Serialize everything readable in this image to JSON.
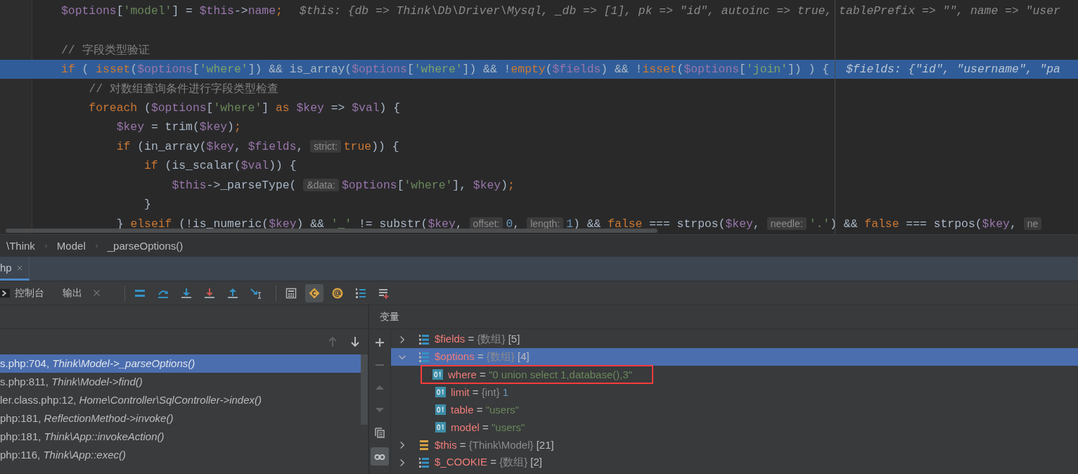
{
  "editor": {
    "lines": [
      {
        "current": false,
        "parts": [
          {
            "kind": "code",
            "tokens": [
              {
                "kind": "var",
                "text": "$options"
              },
              {
                "kind": "plain",
                "text": "["
              },
              {
                "kind": "str",
                "text": "'model'"
              },
              {
                "kind": "plain",
                "text": "] = "
              },
              {
                "kind": "var",
                "text": "$this"
              },
              {
                "kind": "plain",
                "text": "->"
              },
              {
                "kind": "var",
                "text": "name"
              },
              {
                "kind": "kw",
                "text": ";"
              }
            ]
          },
          {
            "kind": "value",
            "text": "$this: {db => Think\\Db\\Driver\\Mysql, _db => [1], pk => \"id\", autoinc => true, tablePrefix => \"\", name => \"user"
          }
        ]
      },
      {
        "current": false
      },
      {
        "current": false,
        "parts": [
          {
            "kind": "code",
            "tokens": [
              {
                "kind": "comment",
                "text": "// 字段类型验证"
              }
            ]
          }
        ]
      },
      {
        "current": true,
        "parts": [
          {
            "kind": "code",
            "tokens": [
              {
                "kind": "kw",
                "text": "if"
              },
              {
                "kind": "plain",
                "text": " ( "
              },
              {
                "kind": "kw",
                "text": "isset"
              },
              {
                "kind": "plain",
                "text": "("
              },
              {
                "kind": "var",
                "text": "$options"
              },
              {
                "kind": "plain",
                "text": "["
              },
              {
                "kind": "str",
                "text": "'where'"
              },
              {
                "kind": "plain",
                "text": "]) && is_array("
              },
              {
                "kind": "var",
                "text": "$options"
              },
              {
                "kind": "plain",
                "text": "["
              },
              {
                "kind": "str",
                "text": "'where'"
              },
              {
                "kind": "plain",
                "text": "]) && !"
              },
              {
                "kind": "kw",
                "text": "empty"
              },
              {
                "kind": "plain",
                "text": "("
              },
              {
                "kind": "var",
                "text": "$fields"
              },
              {
                "kind": "plain",
                "text": ") && !"
              },
              {
                "kind": "kw",
                "text": "isset"
              },
              {
                "kind": "plain",
                "text": "("
              },
              {
                "kind": "var",
                "text": "$options"
              },
              {
                "kind": "plain",
                "text": "["
              },
              {
                "kind": "str",
                "text": "'join'"
              },
              {
                "kind": "plain",
                "text": "]) ) {"
              }
            ]
          },
          {
            "kind": "value",
            "text": "$fields: {\"id\", \"username\", \"pa"
          }
        ]
      },
      {
        "current": false,
        "parts": [
          {
            "kind": "code",
            "tokens": [
              {
                "kind": "comment",
                "text": "    // 对数组查询条件进行字段类型检查"
              }
            ]
          }
        ]
      },
      {
        "current": false,
        "parts": [
          {
            "kind": "code",
            "tokens": [
              {
                "kind": "kw",
                "text": "    foreach"
              },
              {
                "kind": "plain",
                "text": " ("
              },
              {
                "kind": "var",
                "text": "$options"
              },
              {
                "kind": "plain",
                "text": "["
              },
              {
                "kind": "str",
                "text": "'where'"
              },
              {
                "kind": "plain",
                "text": "] "
              },
              {
                "kind": "kw",
                "text": "as"
              },
              {
                "kind": "var",
                "text": " $key"
              },
              {
                "kind": "plain",
                "text": " => "
              },
              {
                "kind": "var",
                "text": "$val"
              },
              {
                "kind": "plain",
                "text": ") {"
              }
            ]
          }
        ]
      },
      {
        "current": false,
        "parts": [
          {
            "kind": "code",
            "tokens": [
              {
                "kind": "var",
                "text": "        $key"
              },
              {
                "kind": "plain",
                "text": " = trim("
              },
              {
                "kind": "var",
                "text": "$key"
              },
              {
                "kind": "plain",
                "text": ")"
              },
              {
                "kind": "kw",
                "text": ";"
              }
            ]
          }
        ]
      },
      {
        "current": false,
        "parts": [
          {
            "kind": "code",
            "tokens": [
              {
                "kind": "kw",
                "text": "        if"
              },
              {
                "kind": "plain",
                "text": " (in_array("
              },
              {
                "kind": "var",
                "text": "$key"
              },
              {
                "kind": "plain",
                "text": ", "
              },
              {
                "kind": "var",
                "text": "$fields"
              },
              {
                "kind": "plain",
                "text": ","
              }
            ]
          },
          {
            "kind": "hint",
            "text": "strict:"
          },
          {
            "kind": "code",
            "tokens": [
              {
                "kind": "kw",
                "text": "true"
              },
              {
                "kind": "plain",
                "text": ")) {"
              }
            ]
          }
        ]
      },
      {
        "current": false,
        "parts": [
          {
            "kind": "code",
            "tokens": [
              {
                "kind": "kw",
                "text": "            if"
              },
              {
                "kind": "plain",
                "text": " (is_scalar("
              },
              {
                "kind": "var",
                "text": "$val"
              },
              {
                "kind": "plain",
                "text": ")) {"
              }
            ]
          }
        ]
      },
      {
        "current": false,
        "parts": [
          {
            "kind": "code",
            "tokens": [
              {
                "kind": "var",
                "text": "                $this"
              },
              {
                "kind": "plain",
                "text": "->_parseType("
              }
            ]
          },
          {
            "kind": "hint",
            "text": "&data:"
          },
          {
            "kind": "code",
            "tokens": [
              {
                "kind": "var",
                "text": "$options"
              },
              {
                "kind": "plain",
                "text": "["
              },
              {
                "kind": "str",
                "text": "'where'"
              },
              {
                "kind": "plain",
                "text": "], "
              },
              {
                "kind": "var",
                "text": "$key"
              },
              {
                "kind": "plain",
                "text": ")"
              },
              {
                "kind": "kw",
                "text": ";"
              }
            ]
          }
        ]
      },
      {
        "current": false,
        "parts": [
          {
            "kind": "code",
            "tokens": [
              {
                "kind": "plain",
                "text": "            }"
              }
            ]
          }
        ]
      },
      {
        "current": false,
        "parts": [
          {
            "kind": "code",
            "tokens": [
              {
                "kind": "plain",
                "text": "        } "
              },
              {
                "kind": "kw",
                "text": "elseif"
              },
              {
                "kind": "plain",
                "text": " (!is_numeric("
              },
              {
                "kind": "var",
                "text": "$key"
              },
              {
                "kind": "plain",
                "text": ") && "
              },
              {
                "kind": "str",
                "text": "'_'"
              },
              {
                "kind": "plain",
                "text": " != substr("
              },
              {
                "kind": "var",
                "text": "$key"
              },
              {
                "kind": "plain",
                "text": ","
              }
            ]
          },
          {
            "kind": "hint",
            "text": "offset:"
          },
          {
            "kind": "code",
            "tokens": [
              {
                "kind": "num",
                "text": "0"
              },
              {
                "kind": "plain",
                "text": ","
              }
            ]
          },
          {
            "kind": "hint",
            "text": "length:"
          },
          {
            "kind": "code",
            "tokens": [
              {
                "kind": "num",
                "text": "1"
              },
              {
                "kind": "plain",
                "text": ") && "
              },
              {
                "kind": "kw",
                "text": "false"
              },
              {
                "kind": "plain",
                "text": " === strpos("
              },
              {
                "kind": "var",
                "text": "$key"
              },
              {
                "kind": "plain",
                "text": ","
              }
            ]
          },
          {
            "kind": "hint",
            "text": "needle:"
          },
          {
            "kind": "code",
            "tokens": [
              {
                "kind": "str",
                "text": "'.'"
              },
              {
                "kind": "plain",
                "text": ") && "
              },
              {
                "kind": "kw",
                "text": "false"
              },
              {
                "kind": "plain",
                "text": " === strpos("
              },
              {
                "kind": "var",
                "text": "$key"
              },
              {
                "kind": "plain",
                "text": ","
              }
            ]
          },
          {
            "kind": "hint",
            "text": "ne"
          }
        ]
      }
    ]
  },
  "breadcrumbs": [
    "\\Think",
    "Model",
    "_parseOptions()"
  ],
  "tool_tabs": [
    {
      "label": "hp",
      "selected": true
    }
  ],
  "debug_toolbar": {
    "tabs": [
      {
        "kind": "console",
        "label": "控制台"
      },
      {
        "kind": "output",
        "label": "输出"
      }
    ],
    "buttons": [
      {
        "kind": "lines",
        "on": false
      },
      {
        "kind": "step-over",
        "on": false
      },
      {
        "kind": "step-into",
        "on": false
      },
      {
        "kind": "force-step-into",
        "on": false
      },
      {
        "kind": "step-out",
        "on": false
      },
      {
        "kind": "run-to-cursor",
        "on": false
      },
      {
        "kind": "evaluate",
        "on": false
      },
      {
        "kind": "diamond",
        "on": true
      },
      {
        "kind": "at",
        "on": false
      },
      {
        "kind": "numbered",
        "on": false
      },
      {
        "kind": "add-list",
        "on": false
      }
    ]
  },
  "frames": {
    "nav": [
      {
        "kind": "up",
        "disabled": true
      },
      {
        "kind": "down",
        "disabled": false
      }
    ],
    "rows": [
      {
        "text": "s.php:704, *Think\\Model->_parseOptions()*",
        "selected": true
      },
      {
        "text": "s.php:811, *Think\\Model->find()*",
        "selected": false
      },
      {
        "text": "ler.class.php:12, *Home\\Controller\\SqlController->index()*",
        "selected": false
      },
      {
        "text": "php:181, *ReflectionMethod->invoke()*",
        "selected": false
      },
      {
        "text": "php:181, *Think\\App::invokeAction()*",
        "selected": false
      },
      {
        "text": "php:116, *Think\\App::exec()*",
        "selected": false
      }
    ]
  },
  "variables": {
    "title": "变量",
    "tools": [
      {
        "kind": "add",
        "disabled": false,
        "on": false
      },
      {
        "kind": "remove",
        "disabled": true,
        "on": false
      },
      {
        "kind": "up",
        "disabled": true,
        "on": false
      },
      {
        "kind": "down",
        "disabled": true,
        "on": false
      },
      {
        "kind": "copy",
        "disabled": false,
        "on": false
      },
      {
        "kind": "watches",
        "disabled": false,
        "on": true
      }
    ],
    "items": [
      {
        "name": "$fields",
        "operator": "=",
        "type": "{数组}",
        "value": "[5]",
        "color": "#bbbbbb",
        "kind": "array",
        "expanded": false,
        "selected": false
      },
      {
        "name": "$options",
        "operator": "=",
        "type": "{数组}",
        "value": "[4]",
        "color": "#bbbbbb",
        "kind": "array",
        "expanded": true,
        "selected": true,
        "children": [
          {
            "name": "where",
            "operator": "=",
            "value": "\"0 union select 1,database(),3\"",
            "color": "#6a8759",
            "kind": "scalar",
            "marked": true,
            "selected": false
          },
          {
            "name": "limit",
            "operator": "=",
            "type": "{int}",
            "value": "1",
            "color": "#6897bb",
            "kind": "scalar",
            "marked": false,
            "selected": false
          },
          {
            "name": "table",
            "operator": "=",
            "value": "\"users\"",
            "color": "#6a8759",
            "kind": "scalar",
            "marked": false,
            "selected": false
          },
          {
            "name": "model",
            "operator": "=",
            "value": "\"users\"",
            "color": "#6a8759",
            "kind": "scalar",
            "marked": false,
            "selected": false
          }
        ]
      },
      {
        "name": "$this",
        "operator": "=",
        "type": "{Think\\Model}",
        "value": "[21]",
        "color": "#bbbbbb",
        "kind": "object",
        "expanded": false,
        "selected": false
      },
      {
        "name": "$_COOKIE",
        "operator": "=",
        "type": "{数组}",
        "value": "[2]",
        "color": "#bbbbbb",
        "kind": "array",
        "expanded": false,
        "selected": false
      }
    ]
  }
}
